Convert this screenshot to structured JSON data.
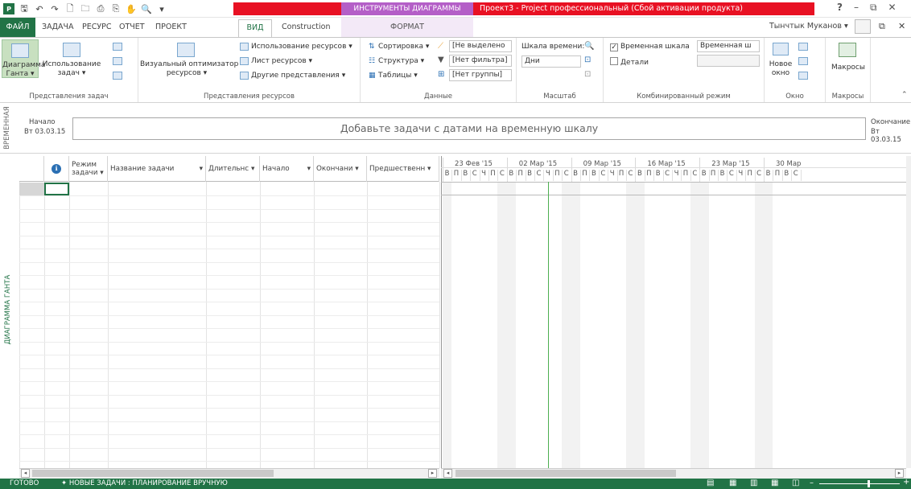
{
  "title_bar": {
    "contextual_group": "ИНСТРУМЕНТЫ ДИАГРАММЫ ГАНТА",
    "window_title": "Проект3 - Project профессиональный (Сбой активации продукта)",
    "help": "?",
    "minimize": "–",
    "restore": "⧉",
    "close": "✕"
  },
  "tabs": {
    "file": "ФАЙЛ",
    "task": "ЗАДАЧА",
    "resource": "РЕСУРС",
    "report": "ОТЧЕТ",
    "project": "ПРОЕКТ",
    "view": "ВИД",
    "construction": "Construction",
    "format": "ФОРМАТ",
    "user": "Тынчтык Муканов ▾",
    "restore2": "⧉",
    "close2": "✕"
  },
  "ribbon": {
    "task_views": {
      "gantt_line1": "Диаграмма",
      "gantt_line2": "Ганта ▾",
      "usage_line1": "Использование",
      "usage_line2": "задач ▾",
      "label": "Представления задач"
    },
    "resource_views": {
      "planner_line1": "Визуальный оптимизатор",
      "planner_line2": "ресурсов ▾",
      "usage": "Использование ресурсов ▾",
      "sheet": "Лист ресурсов ▾",
      "other": "Другие представления ▾",
      "label": "Представления ресурсов"
    },
    "data": {
      "sort": "Сортировка ▾",
      "outline": "Структура ▾",
      "tables": "Таблицы ▾",
      "highlight": "[Не выделено",
      "filter": "[Нет фильтра]",
      "group": "[Нет группы]",
      "label": "Данные"
    },
    "zoom": {
      "timescale_label": "Шкала времени:",
      "timescale_value": "Дни",
      "label": "Масштаб"
    },
    "split_view": {
      "timeline_check": "Временная шкала",
      "timeline_value": "Временная ш",
      "details_check": "Детали",
      "label": "Комбинированный режим"
    },
    "window": {
      "new_line1": "Новое",
      "new_line2": "окно",
      "label": "Окно"
    },
    "macros": {
      "button": "Макросы",
      "label": "Макросы"
    }
  },
  "timeline": {
    "side_label": "ВРЕМЕННАЯ",
    "start_label": "Начало",
    "start_date": "Вт 03.03.15",
    "end_label": "Окончание",
    "end_date": "Вт 03.03.15",
    "placeholder": "Добавьте задачи с датами на временную шкалу"
  },
  "sheet": {
    "side_label": "ДИАГРАММА ГАНТА",
    "columns": {
      "info": "ℹ",
      "mode_line1": "Режим",
      "mode_line2": "задачи ▾",
      "name": "Название задачи",
      "duration": "Длительнс ▾",
      "start": "Начало",
      "finish": "Окончани ▾",
      "predecessors": "Предшественн ▾"
    }
  },
  "gantt": {
    "weeks": [
      "23 Фев '15",
      "02 Мар '15",
      "09 Мар '15",
      "16 Мар '15",
      "23 Мар '15",
      "30 Мар"
    ],
    "day_letters": [
      "В",
      "П",
      "В",
      "С",
      "Ч",
      "П",
      "С",
      "В",
      "П",
      "В",
      "С",
      "Ч",
      "П",
      "С",
      "В",
      "П",
      "В",
      "С",
      "Ч",
      "П",
      "С",
      "В",
      "П",
      "В",
      "С",
      "Ч",
      "П",
      "С",
      "В",
      "П",
      "В",
      "С",
      "Ч",
      "П",
      "С",
      "В",
      "П",
      "В",
      "С"
    ]
  },
  "status": {
    "ready": "ГОТОВО",
    "mode": "✦ НОВЫЕ ЗАДАЧИ : ПЛАНИРОВАНИЕ ВРУЧНУЮ"
  },
  "colors": {
    "accent": "#217346",
    "title_red": "#e81123",
    "gantt_tools": "#b45fc7"
  }
}
